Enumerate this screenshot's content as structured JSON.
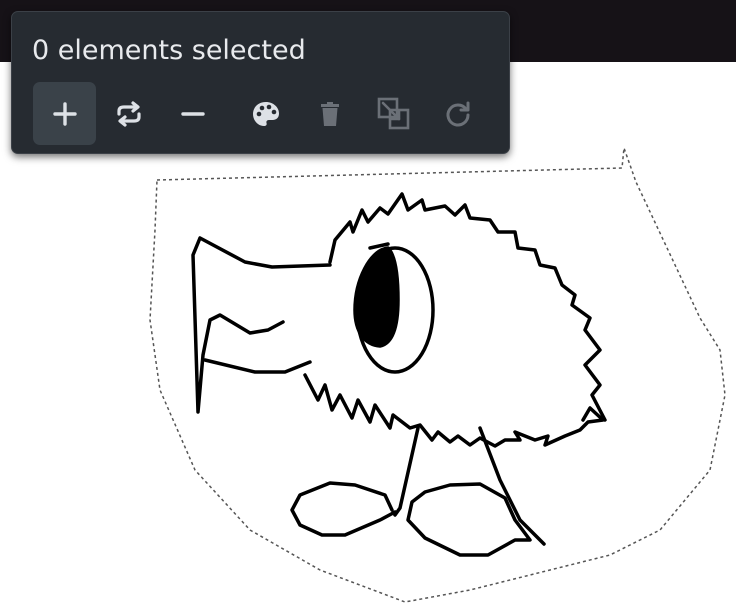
{
  "selection": {
    "status_text": "0 elements selected"
  },
  "toolbar": {
    "buttons": [
      {
        "name": "add-button",
        "icon": "plus-icon",
        "enabled": true,
        "active": true
      },
      {
        "name": "swap-button",
        "icon": "repeat-arrows-icon",
        "enabled": true,
        "active": false
      },
      {
        "name": "remove-button",
        "icon": "minus-icon",
        "enabled": true,
        "active": false
      },
      {
        "name": "color-button",
        "icon": "palette-icon",
        "enabled": true,
        "active": false
      },
      {
        "name": "delete-button",
        "icon": "trash-icon",
        "enabled": false,
        "active": false
      },
      {
        "name": "duplicate-button",
        "icon": "duplicate-icon",
        "enabled": false,
        "active": false
      },
      {
        "name": "redo-button",
        "icon": "redo-icon",
        "enabled": false,
        "active": false
      }
    ]
  },
  "colors": {
    "toolbar_bg": "#262b31",
    "top_bar": "#161217",
    "icon_enabled": "#dde1e6",
    "icon_disabled": "#6b7077",
    "active_button_bg": "#3a4249",
    "ink": "#000000"
  }
}
